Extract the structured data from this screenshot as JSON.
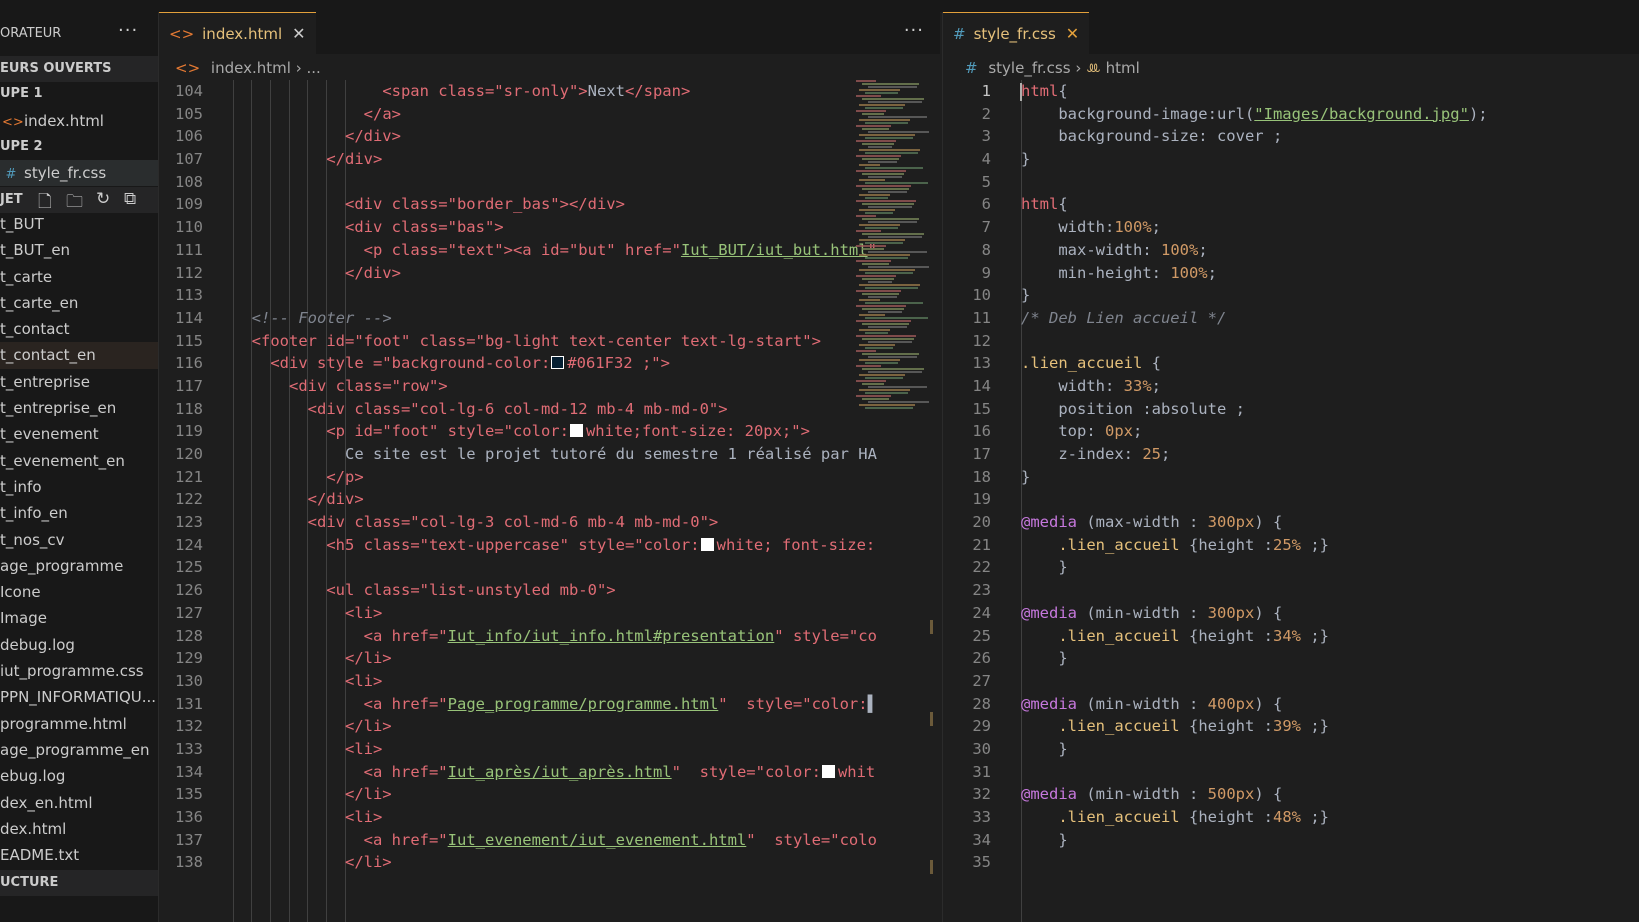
{
  "sidebar": {
    "header": "ORATEUR",
    "open_editors": "EURS OUVERTS",
    "group1": "UPE 1",
    "group1_file": "index.html",
    "group2": "UPE 2",
    "group2_file": "style_fr.css",
    "project": "JET",
    "tree": [
      "t_BUT",
      "t_BUT_en",
      "t_carte",
      "t_carte_en",
      "t_contact",
      "t_contact_en",
      "t_entreprise",
      "t_entreprise_en",
      "t_evenement",
      "t_evenement_en",
      "t_info",
      "t_info_en",
      "t_nos_cv",
      "age_programme",
      "Icone",
      "Image",
      "debug.log",
      "iut_programme.css",
      "PPN_INFORMATIQU...",
      "programme.html",
      "age_programme_en",
      "ebug.log",
      "dex_en.html",
      "dex.html",
      "EADME.txt"
    ],
    "structure": "UCTURE"
  },
  "left": {
    "tab": "index.html",
    "crumb_file": "index.html",
    "crumb_more": "...",
    "first_line": 104,
    "lines": [
      [
        [
          8,
          "<span class=\"sr-only\">",
          "tg"
        ],
        [
          0,
          "Next",
          "pl"
        ],
        [
          0,
          "</span>",
          "tg"
        ]
      ],
      [
        [
          7,
          "</a>",
          "tg"
        ]
      ],
      [
        [
          6,
          "</div>",
          "tg"
        ]
      ],
      [
        [
          5,
          "</div>",
          "tg"
        ]
      ],
      [],
      [
        [
          6,
          "<div class=\"border_bas\"></div>",
          "tg"
        ]
      ],
      [
        [
          6,
          "<div class=\"bas\">",
          "tg"
        ]
      ],
      [
        [
          7,
          "<p class=\"text\"><a id=\"but\" href=\"",
          "tg"
        ],
        [
          0,
          "Iut_BUT/iut_but.html",
          "st ul"
        ],
        [
          0,
          "\"",
          "tg"
        ]
      ],
      [
        [
          6,
          "</div>",
          "tg"
        ]
      ],
      [],
      [
        [
          1,
          "<!-- Footer -->",
          "cm"
        ]
      ],
      [
        [
          1,
          "<footer id=\"foot\" class=\"bg-light text-center text-lg-start\">",
          "tg"
        ]
      ],
      [
        [
          2,
          "<div style =\"background-color:",
          "tg"
        ],
        [
          0,
          "SW",
          "sw"
        ],
        [
          0,
          "#061F32 ;\">",
          "tg"
        ]
      ],
      [
        [
          3,
          "<div class=\"row\">",
          "tg"
        ]
      ],
      [
        [
          4,
          "<div class=\"col-lg-6 col-md-12 mb-4 mb-md-0\">",
          "tg"
        ]
      ],
      [
        [
          5,
          "<p id=\"foot\" style=\"color:",
          "tg"
        ],
        [
          0,
          "SWW",
          "sw"
        ],
        [
          0,
          "white;font-size: 20px;\">",
          "tg"
        ]
      ],
      [
        [
          6,
          "Ce site est le projet tutoré du semestre 1 réalisé par HA",
          "pl"
        ]
      ],
      [
        [
          5,
          "</p>",
          "tg"
        ]
      ],
      [
        [
          4,
          "</div>",
          "tg"
        ]
      ],
      [
        [
          4,
          "<div class=\"col-lg-3 col-md-6 mb-4 mb-md-0\">",
          "tg"
        ]
      ],
      [
        [
          5,
          "<h5 class=\"text-uppercase\" style=\"color:",
          "tg"
        ],
        [
          0,
          "SWW",
          "sw"
        ],
        [
          0,
          "white; font-size:",
          "tg"
        ]
      ],
      [],
      [
        [
          5,
          "<ul class=\"list-unstyled mb-0\">",
          "tg"
        ]
      ],
      [
        [
          6,
          "<li>",
          "tg"
        ]
      ],
      [
        [
          7,
          "<a href=\"",
          "tg"
        ],
        [
          0,
          "Iut_info/iut_info.html#presentation",
          "st ul"
        ],
        [
          0,
          "\" style=\"co",
          "tg"
        ]
      ],
      [
        [
          6,
          "</li>",
          "tg"
        ]
      ],
      [
        [
          6,
          "<li>",
          "tg"
        ]
      ],
      [
        [
          7,
          "<a href=\"",
          "tg"
        ],
        [
          0,
          "Page_programme/programme.html",
          "st ul"
        ],
        [
          0,
          "\"  style=\"color:",
          "tg"
        ],
        [
          0,
          "▌",
          "pl"
        ]
      ],
      [
        [
          6,
          "</li>",
          "tg"
        ]
      ],
      [
        [
          6,
          "<li>",
          "tg"
        ]
      ],
      [
        [
          7,
          "<a href=\"",
          "tg"
        ],
        [
          0,
          "Iut_après/iut_après.html",
          "st ul"
        ],
        [
          0,
          "\"  style=\"color:",
          "tg"
        ],
        [
          0,
          "SWW",
          "sw"
        ],
        [
          0,
          "whit",
          "tg"
        ]
      ],
      [
        [
          6,
          "</li>",
          "tg"
        ]
      ],
      [
        [
          6,
          "<li>",
          "tg"
        ]
      ],
      [
        [
          7,
          "<a href=\"",
          "tg"
        ],
        [
          0,
          "Iut_evenement/iut_evenement.html",
          "st ul"
        ],
        [
          0,
          "\"  style=\"colo",
          "tg"
        ]
      ],
      [
        [
          6,
          "</li>",
          "tg"
        ]
      ]
    ]
  },
  "right": {
    "tab": "style_fr.css",
    "crumb_file": "style_fr.css",
    "crumb_selector": "html",
    "first_line": 1,
    "current_line": 1,
    "lines": [
      [
        [
          0,
          "html",
          "tg"
        ],
        [
          0,
          "{",
          "pl"
        ]
      ],
      [
        [
          2,
          "background-image:",
          "pl"
        ],
        [
          0,
          "url(",
          "pl"
        ],
        [
          0,
          "\"Images/background.jpg\"",
          "st ul"
        ],
        [
          0,
          ");",
          "pl"
        ]
      ],
      [
        [
          2,
          "background-size: cover ;",
          "pl"
        ]
      ],
      [
        [
          0,
          "}",
          "pl"
        ]
      ],
      [],
      [
        [
          0,
          "html",
          "tg"
        ],
        [
          0,
          "{",
          "pl"
        ]
      ],
      [
        [
          2,
          "width:",
          "pl"
        ],
        [
          0,
          "100%",
          "nu"
        ],
        [
          0,
          ";",
          "pl"
        ]
      ],
      [
        [
          2,
          "max-width: ",
          "pl"
        ],
        [
          0,
          "100%",
          "nu"
        ],
        [
          0,
          ";",
          "pl"
        ]
      ],
      [
        [
          2,
          "min-height: ",
          "pl"
        ],
        [
          0,
          "100%",
          "nu"
        ],
        [
          0,
          ";",
          "pl"
        ]
      ],
      [
        [
          0,
          "}",
          "pl"
        ]
      ],
      [
        [
          0,
          "/* Deb Lien accueil */",
          "cm"
        ]
      ],
      [],
      [
        [
          0,
          ".lien_accueil",
          "sel"
        ],
        [
          0,
          " {",
          "pl"
        ]
      ],
      [
        [
          2,
          "width: ",
          "pl"
        ],
        [
          0,
          "33%",
          "nu"
        ],
        [
          0,
          ";",
          "pl"
        ]
      ],
      [
        [
          2,
          "position :absolute ;",
          "pl"
        ]
      ],
      [
        [
          2,
          "top: ",
          "pl"
        ],
        [
          0,
          "0px",
          "nu"
        ],
        [
          0,
          ";",
          "pl"
        ]
      ],
      [
        [
          2,
          "z-index: ",
          "pl"
        ],
        [
          0,
          "25",
          "nu"
        ],
        [
          0,
          ";",
          "pl"
        ]
      ],
      [
        [
          0,
          "}",
          "pl"
        ]
      ],
      [],
      [
        [
          0,
          "@media",
          "kw"
        ],
        [
          0,
          " (max-width : ",
          "pl"
        ],
        [
          0,
          "300px",
          "nu"
        ],
        [
          0,
          ") {",
          "pl"
        ]
      ],
      [
        [
          2,
          ".lien_accueil",
          "sel"
        ],
        [
          0,
          " {height :",
          "pl"
        ],
        [
          0,
          "25%",
          "nu"
        ],
        [
          0,
          " ;}",
          "pl"
        ]
      ],
      [
        [
          2,
          "}",
          "pl"
        ]
      ],
      [],
      [
        [
          0,
          "@media",
          "kw"
        ],
        [
          0,
          " (min-width : ",
          "pl"
        ],
        [
          0,
          "300px",
          "nu"
        ],
        [
          0,
          ") {",
          "pl"
        ]
      ],
      [
        [
          2,
          ".lien_accueil",
          "sel"
        ],
        [
          0,
          " {height :",
          "pl"
        ],
        [
          0,
          "34%",
          "nu"
        ],
        [
          0,
          " ;}",
          "pl"
        ]
      ],
      [
        [
          2,
          "}",
          "pl"
        ]
      ],
      [],
      [
        [
          0,
          "@media",
          "kw"
        ],
        [
          0,
          " (min-width : ",
          "pl"
        ],
        [
          0,
          "400px",
          "nu"
        ],
        [
          0,
          ") {",
          "pl"
        ]
      ],
      [
        [
          2,
          ".lien_accueil",
          "sel"
        ],
        [
          0,
          " {height :",
          "pl"
        ],
        [
          0,
          "39%",
          "nu"
        ],
        [
          0,
          " ;}",
          "pl"
        ]
      ],
      [
        [
          2,
          "}",
          "pl"
        ]
      ],
      [],
      [
        [
          0,
          "@media",
          "kw"
        ],
        [
          0,
          " (min-width : ",
          "pl"
        ],
        [
          0,
          "500px",
          "nu"
        ],
        [
          0,
          ") {",
          "pl"
        ]
      ],
      [
        [
          2,
          ".lien_accueil",
          "sel"
        ],
        [
          0,
          " {height :",
          "pl"
        ],
        [
          0,
          "48%",
          "nu"
        ],
        [
          0,
          " ;}",
          "pl"
        ]
      ],
      [
        [
          2,
          "}",
          "pl"
        ]
      ],
      []
    ]
  },
  "colors": {
    "accent": "#e2a03b",
    "html_icon": "#e37933",
    "css_icon": "#519aba"
  }
}
